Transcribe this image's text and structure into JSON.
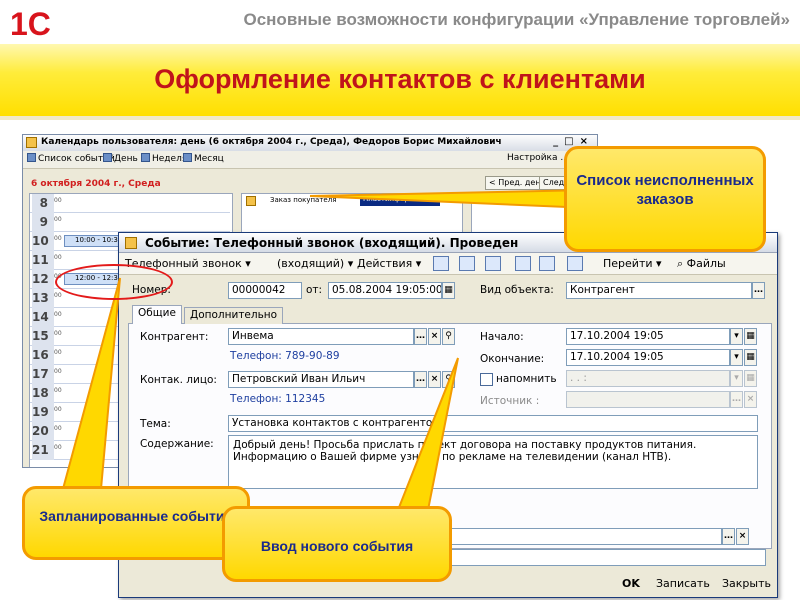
{
  "slide": {
    "logo_text": "1С",
    "subtitle": "Основные возможности конфигурации «Управление торговлей»",
    "title": "Оформление контактов с клиентами"
  },
  "calendar_window": {
    "title": "Календарь пользователя: день (6 октября 2004 г., Среда), Федоров Борис Михайлович",
    "toolbar": [
      "Список событий",
      "День",
      "Неделя",
      "Месяц"
    ],
    "settings": "Настройка ...",
    "date_label": "6 октября 2004 г., Среда",
    "prev_day": "< Пред. день",
    "next_day": "След.",
    "hours": [
      "8",
      "9",
      "10",
      "11",
      "12",
      "13",
      "14",
      "15",
      "16",
      "17",
      "18",
      "19",
      "20",
      "21"
    ],
    "hour_sub": "00",
    "events": [
      {
        "hour": "10",
        "text": "10:00 - 10:30"
      },
      {
        "hour": "12",
        "text": "12:00 - 12:30"
      }
    ],
    "orders_row": {
      "doc": "Заказ покупателя",
      "client": "Пластинформ"
    }
  },
  "dialog": {
    "title": "Событие: Телефонный звонок (входящий). Проведен",
    "toolbar": {
      "type": "Телефонный звонок",
      "direction": "(входящий)",
      "actions": "Действия",
      "goto": "Перейти",
      "files": "Файлы"
    },
    "number_label": "Номер:",
    "number": "00000042",
    "from_label": "от:",
    "date": "05.08.2004 19:05:00",
    "object_type_label": "Вид объекта:",
    "object_type": "Контрагент",
    "tabs": [
      "Общие",
      "Дополнительно"
    ],
    "counterparty_label": "Контрагент:",
    "counterparty": "Инвема",
    "counterparty_phone": "Телефон: 789-90-89",
    "contact_label": "Контак. лицо:",
    "contact": "Петровский Иван Ильич",
    "contact_phone": "Телефон: 112345",
    "start_label": "Начало:",
    "start": "17.10.2004 19:05",
    "end_label": "Окончание:",
    "end": "17.10.2004 19:05",
    "remind_label": "напомнить",
    "remind_value": ". .   :",
    "source_label": "Источник :",
    "topic_label": "Тема:",
    "topic": "Установка контактов с контрагентом",
    "content_label": "Содержание:",
    "content_line1": "Добрый день! Просьба прислать проект договора на поставку продуктов питания.",
    "content_line2": "Информацию о Вашей фирме узнали по рекламе на телевидении (канал НТВ).",
    "ok": "OK",
    "save": "Записать",
    "close": "Закрыть"
  },
  "callouts": {
    "orders": "Список неисполненных заказов",
    "planned": "Запланированные события",
    "new_event": "Ввод нового события"
  },
  "colors": {
    "title_red": "#c0141b",
    "callout_fill": "#ffd800",
    "callout_border": "#f39b00",
    "callout_text": "#1a2a8c",
    "highlight_red": "#e31a1a"
  }
}
